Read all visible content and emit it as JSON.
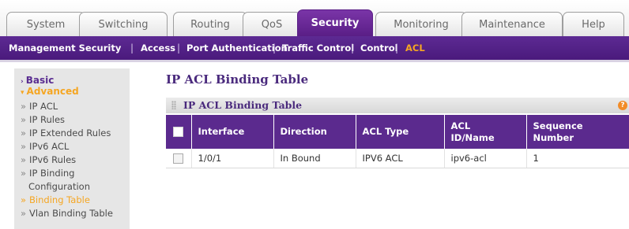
{
  "tabs": [
    {
      "label": "System",
      "active": false
    },
    {
      "label": "Switching",
      "active": false
    },
    {
      "label": "Routing",
      "active": false
    },
    {
      "label": "QoS",
      "active": false
    },
    {
      "label": "Security",
      "active": true
    },
    {
      "label": "Monitoring",
      "active": false
    },
    {
      "label": "Maintenance",
      "active": false
    },
    {
      "label": "Help",
      "active": false
    }
  ],
  "subnav": [
    {
      "label": "Management Security",
      "active": false
    },
    {
      "label": "Access",
      "active": false
    },
    {
      "label": "Port Authentication",
      "active": false
    },
    {
      "label": "Traffic Control",
      "active": false
    },
    {
      "label": "Control",
      "active": false
    },
    {
      "label": "ACL",
      "active": true
    }
  ],
  "sidebar": {
    "sections": [
      {
        "label": "Basic",
        "expanded": false
      },
      {
        "label": "Advanced",
        "expanded": true
      }
    ],
    "items": [
      {
        "label": "IP ACL"
      },
      {
        "label": "IP Rules"
      },
      {
        "label": "IP Extended Rules"
      },
      {
        "label": "IPv6 ACL"
      },
      {
        "label": "IPv6 Rules"
      },
      {
        "label": "IP Binding"
      },
      {
        "label": "Configuration"
      },
      {
        "label": "Binding Table",
        "active": true
      },
      {
        "label": "Vlan Binding Table"
      }
    ]
  },
  "page_title": "IP ACL Binding Table",
  "panel": {
    "title": "IP ACL Binding Table",
    "help": "?"
  },
  "table": {
    "headers": {
      "interface": "Interface",
      "direction": "Direction",
      "acl_type": "ACL Type",
      "acl_id_line1": "ACL",
      "acl_id_line2": "ID/Name",
      "seq_line1": "Sequence",
      "seq_line2": "Number"
    },
    "rows": [
      {
        "interface": "1/0/1",
        "direction": "In Bound",
        "acl_type": "IPV6 ACL",
        "acl_id": "ipv6-acl",
        "sequence": "1"
      }
    ]
  },
  "colors": {
    "brand_purple": "#5b2a8e",
    "active_orange": "#f5a623"
  }
}
